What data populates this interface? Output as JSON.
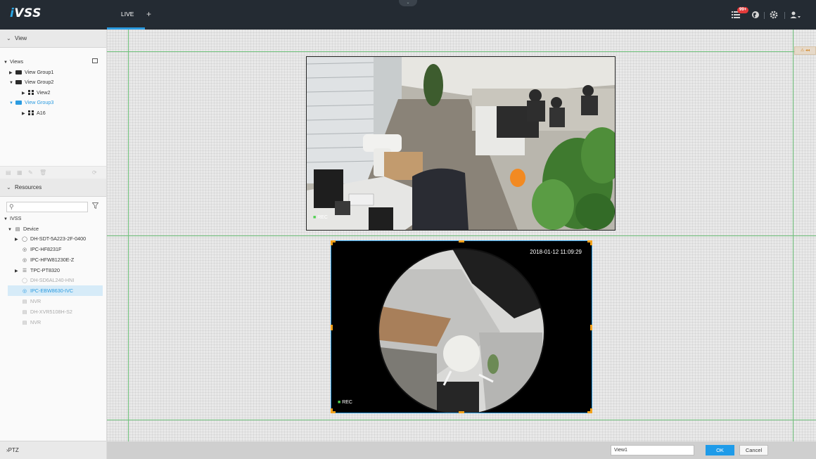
{
  "app": {
    "logo_prefix": "i",
    "logo_rest": "VSS"
  },
  "tabs": {
    "live_label": "LIVE",
    "add_label": "+"
  },
  "header": {
    "collapse_glyph": "⌄",
    "alarm_badge": "99+",
    "icons": [
      "list-alarm-icon",
      "globe-icon",
      "settings-gear-icon",
      "user-icon"
    ]
  },
  "view_panel": {
    "title": "View",
    "tree": [
      {
        "label": "Views",
        "level": 0,
        "expanded": true
      },
      {
        "label": "View Group1",
        "level": 1,
        "expanded": false
      },
      {
        "label": "View Group2",
        "level": 1,
        "expanded": true
      },
      {
        "label": "View2",
        "level": 2
      },
      {
        "label": "View Group3",
        "level": 1,
        "expanded": true,
        "selected": true
      },
      {
        "label": "A16",
        "level": 2
      }
    ]
  },
  "resources_panel": {
    "title": "Resources",
    "search_placeholder": "",
    "tree": [
      {
        "label": "IVSS",
        "level": 0
      },
      {
        "label": "Device",
        "level": 1
      },
      {
        "label": "DH-SDT-5A223-2F-0400",
        "level": 2,
        "icon": "ptz-camera-icon"
      },
      {
        "label": "IPC-HF8231F",
        "level": 2,
        "icon": "camera-icon"
      },
      {
        "label": "IPC-HFW81230E-Z",
        "level": 2,
        "icon": "camera-icon"
      },
      {
        "label": "TPC-PT8320",
        "level": 2,
        "icon": "thermal-camera-icon"
      },
      {
        "label": "DH-SD6AL240-HNI",
        "level": 2,
        "icon": "ptz-camera-icon",
        "offline": true
      },
      {
        "label": "IPC-EBW8630-IVC",
        "level": 2,
        "icon": "camera-icon",
        "selected": true
      },
      {
        "label": "NVR",
        "level": 2,
        "icon": "nvr-icon",
        "offline": true
      },
      {
        "label": "DH-XVR5108H-S2",
        "level": 2,
        "icon": "nvr-icon",
        "offline": true
      },
      {
        "label": "NVR",
        "level": 2,
        "icon": "nvr-icon",
        "offline": true
      }
    ]
  },
  "ptz_panel": {
    "title": "PTZ"
  },
  "canvas": {
    "warning_tag": "⚠ ◂◂",
    "top_window": {
      "rec_label": "REC"
    },
    "bottom_window": {
      "timestamp": "2018-01-12 11:09:29",
      "rec_label": "REC"
    }
  },
  "footer": {
    "view_name_value": "View1",
    "ok_label": "OK",
    "cancel_label": "Cancel"
  },
  "colors": {
    "accent": "#2b9be0",
    "topbar": "#242b33",
    "gridline": "#6ec27a",
    "handle": "#f3a21b"
  }
}
